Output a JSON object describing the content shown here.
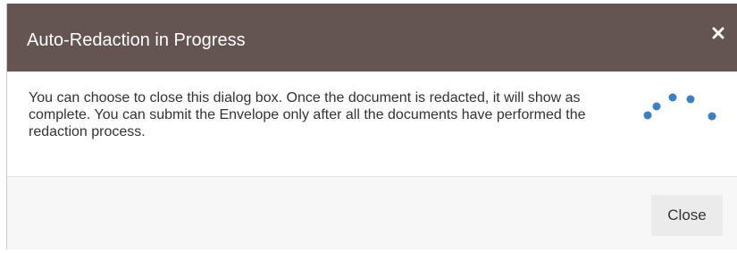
{
  "dialog": {
    "title": "Auto-Redaction in Progress",
    "close_icon": "close-icon",
    "message": "You can choose to close this dialog box. Once the document is redacted, it will show as complete. You can submit the Envelope only after all the documents have performed the redaction process.",
    "spinner_icon": "loading-spinner-icon",
    "close_button_label": "Close"
  },
  "colors": {
    "header_background": "#645552",
    "header_text": "#ffffff",
    "spinner_dots": "#3b7fc4",
    "footer_background": "#f7f7f7",
    "button_background": "#ebebeb"
  }
}
